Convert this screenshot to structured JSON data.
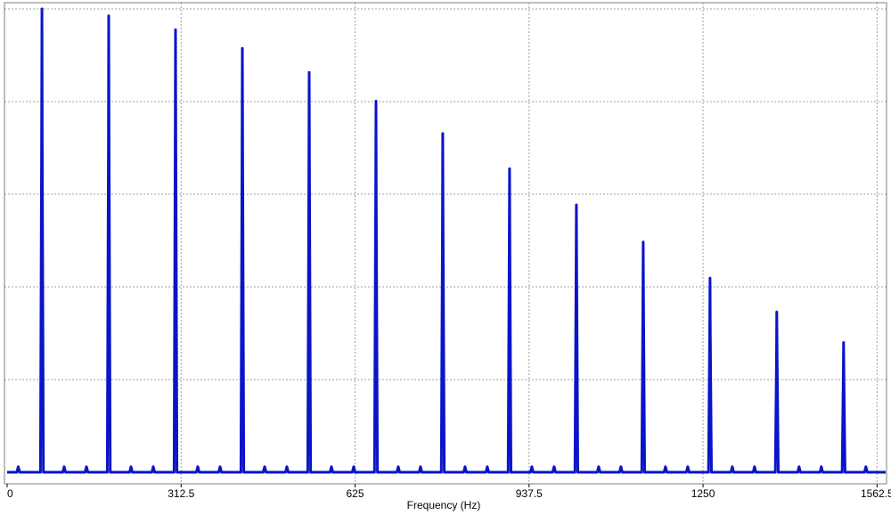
{
  "chart_data": {
    "type": "line",
    "title": "",
    "xlabel": "Frequency (Hz)",
    "ylabel": "",
    "xlim": [
      0,
      1578
    ],
    "ylim": [
      0,
      1.0
    ],
    "x_ticks": [
      0,
      312.5,
      625,
      937.5,
      1250,
      1562.5
    ],
    "x_tick_labels": [
      "0",
      "312.5",
      "625",
      "937.5",
      "1250",
      "1562.5"
    ],
    "y_grid_values": [
      0.2,
      0.4,
      0.6,
      0.8,
      1.0
    ],
    "grid": "dashed",
    "legend": "none",
    "line_color": "#0a14c8",
    "background_color": "#ffffff",
    "baseline": 0.0,
    "peaks": {
      "x": [
        62.5,
        182.5,
        302.5,
        422.5,
        542.5,
        662.5,
        782.5,
        902.5,
        1022.5,
        1142.5,
        1262.5,
        1382.5,
        1502.5
      ],
      "y": [
        1.0,
        0.985,
        0.955,
        0.915,
        0.863,
        0.801,
        0.731,
        0.655,
        0.577,
        0.497,
        0.419,
        0.346,
        0.28
      ]
    },
    "side_ripples": {
      "x": [
        20,
        102.5,
        142.5,
        222.5,
        262.5,
        342.5,
        382.5,
        462.5,
        502.5,
        582.5,
        622.5,
        702.5,
        742.5,
        822.5,
        862.5,
        942.5,
        982.5,
        1062.5,
        1102.5,
        1182.5,
        1222.5,
        1302.5,
        1342.5,
        1422.5,
        1462.5,
        1542.5
      ],
      "y": [
        0.012,
        0.012,
        0.012,
        0.012,
        0.012,
        0.012,
        0.012,
        0.012,
        0.012,
        0.012,
        0.012,
        0.012,
        0.012,
        0.012,
        0.012,
        0.012,
        0.012,
        0.012,
        0.012,
        0.012,
        0.012,
        0.012,
        0.012,
        0.012,
        0.012,
        0.012
      ]
    }
  }
}
